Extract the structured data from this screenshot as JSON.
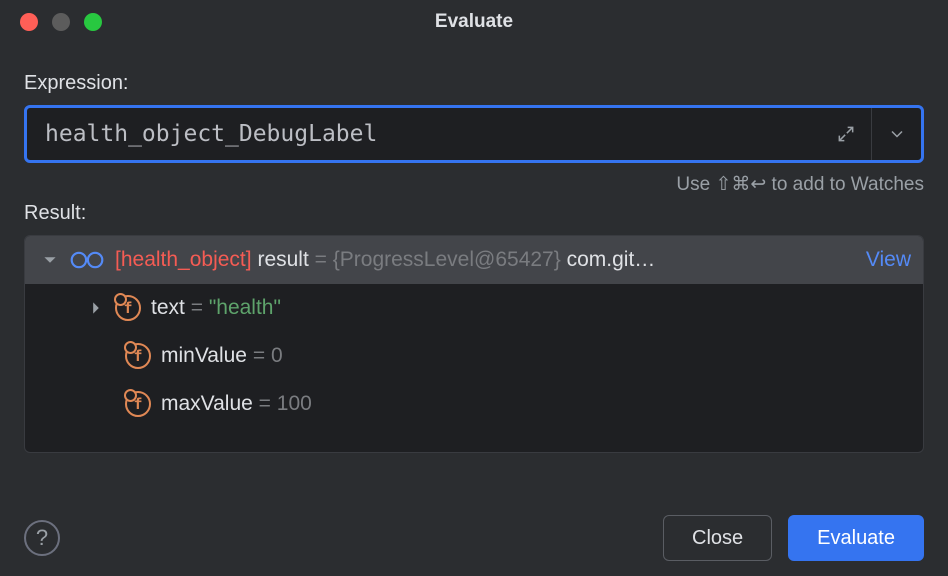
{
  "window": {
    "title": "Evaluate"
  },
  "labels": {
    "expression": "Expression:",
    "result": "Result:"
  },
  "expression": {
    "value": "health_object_DebugLabel"
  },
  "hint": "Use ⇧⌘↩ to add to Watches",
  "result": {
    "root": {
      "mark": "[health_object]",
      "name": "result",
      "eq": "=",
      "type": "{ProgressLevel@65427}",
      "tail": "com.git…",
      "view": "View"
    },
    "fields": [
      {
        "name": "text",
        "eq": "=",
        "value": "\"health\"",
        "expandable": true
      },
      {
        "name": "minValue",
        "eq": "=",
        "value": "0",
        "expandable": false
      },
      {
        "name": "maxValue",
        "eq": "=",
        "value": "100",
        "expandable": false
      }
    ]
  },
  "buttons": {
    "help": "?",
    "close": "Close",
    "evaluate": "Evaluate"
  }
}
